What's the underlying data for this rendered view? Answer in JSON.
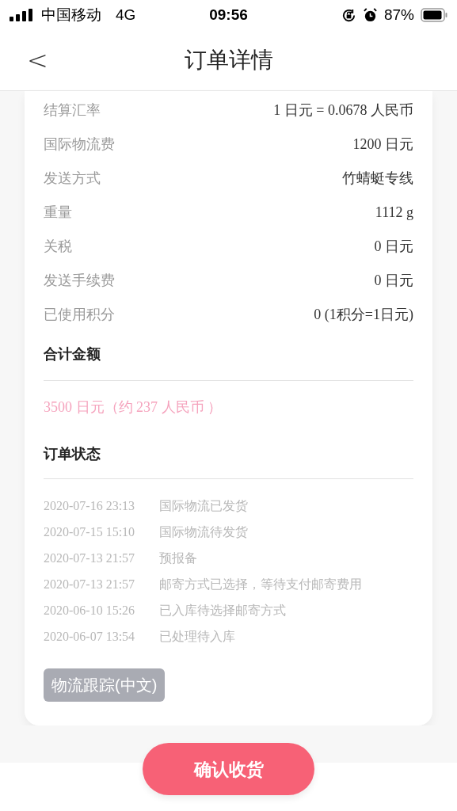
{
  "status_bar": {
    "carrier": "中国移动",
    "network": "4G",
    "time": "09:56",
    "battery": "87%"
  },
  "nav": {
    "back": "<",
    "title": "订单详情"
  },
  "details": [
    {
      "label": "结算汇率",
      "value": "1 日元 = 0.0678 人民币"
    },
    {
      "label": "国际物流费",
      "value": "1200 日元"
    },
    {
      "label": "发送方式",
      "value": "竹蜻蜓专线"
    },
    {
      "label": "重量",
      "value": "1112 g"
    },
    {
      "label": "关税",
      "value": "0 日元"
    },
    {
      "label": "发送手续费",
      "value": "0 日元"
    },
    {
      "label": "已使用积分",
      "value": "0 (1积分=1日元)"
    }
  ],
  "total": {
    "title": "合计金额",
    "amount": "3500 日元（约 237 人民币 ）"
  },
  "order_status": {
    "title": "订单状态",
    "events": [
      {
        "time": "2020-07-16 23:13",
        "text": "国际物流已发货"
      },
      {
        "time": "2020-07-15 15:10",
        "text": "国际物流待发货"
      },
      {
        "time": "2020-07-13 21:57",
        "text": "预报备"
      },
      {
        "time": "2020-07-13 21:57",
        "text": "邮寄方式已选择，等待支付邮寄费用"
      },
      {
        "time": "2020-06-10 15:26",
        "text": "已入库待选择邮寄方式"
      },
      {
        "time": "2020-06-07 13:54",
        "text": "已处理待入库"
      }
    ],
    "tracking_button": "物流跟踪(中文)"
  },
  "confirm_button": "确认收货"
}
